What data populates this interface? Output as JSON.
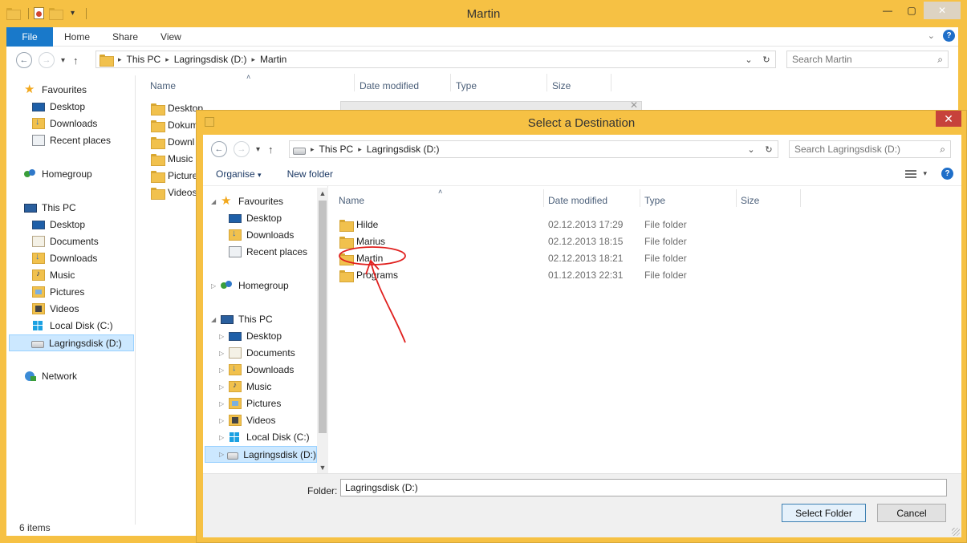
{
  "explorer": {
    "title": "Martin",
    "ribbon_tabs": {
      "file": "File",
      "home": "Home",
      "share": "Share",
      "view": "View"
    },
    "breadcrumb": [
      "This PC",
      "Lagringsdisk (D:)",
      "Martin"
    ],
    "search_placeholder": "Search Martin",
    "columns": {
      "name": "Name",
      "date": "Date modified",
      "type": "Type",
      "size": "Size"
    },
    "files": [
      "Desktop",
      "Dokum",
      "Downl",
      "Music",
      "Picture",
      "Videos"
    ],
    "nav": {
      "favourites": "Favourites",
      "fav_items": [
        "Desktop",
        "Downloads",
        "Recent places"
      ],
      "homegroup": "Homegroup",
      "this_pc": "This PC",
      "pc_items": [
        "Desktop",
        "Documents",
        "Downloads",
        "Music",
        "Pictures",
        "Videos",
        "Local Disk (C:)",
        "Lagringsdisk (D:)"
      ],
      "network": "Network"
    },
    "status": "6 items"
  },
  "dialog": {
    "title": "Select a Destination",
    "breadcrumb": [
      "This PC",
      "Lagringsdisk (D:)"
    ],
    "search_placeholder": "Search Lagringsdisk (D:)",
    "toolbar": {
      "organise": "Organise",
      "new_folder": "New folder"
    },
    "columns": {
      "name": "Name",
      "date": "Date modified",
      "type": "Type",
      "size": "Size"
    },
    "folders": [
      {
        "name": "Hilde",
        "date": "02.12.2013 17:29",
        "type": "File folder"
      },
      {
        "name": "Marius",
        "date": "02.12.2013 18:15",
        "type": "File folder"
      },
      {
        "name": "Martin",
        "date": "02.12.2013 18:21",
        "type": "File folder"
      },
      {
        "name": "Programs",
        "date": "01.12.2013 22:31",
        "type": "File folder"
      }
    ],
    "nav": {
      "favourites": "Favourites",
      "fav_items": [
        "Desktop",
        "Downloads",
        "Recent places"
      ],
      "homegroup": "Homegroup",
      "this_pc": "This PC",
      "pc_items": [
        "Desktop",
        "Documents",
        "Downloads",
        "Music",
        "Pictures",
        "Videos",
        "Local Disk (C:)",
        "Lagringsdisk (D:)"
      ]
    },
    "folder_label": "Folder:",
    "folder_value": "Lagringsdisk (D:)",
    "select_button": "Select Folder",
    "cancel_button": "Cancel"
  },
  "colors": {
    "window_frame": "#f6c144",
    "file_tab": "#1979ca",
    "dialog_close": "#c7423b",
    "annotation": "#e0201e"
  }
}
